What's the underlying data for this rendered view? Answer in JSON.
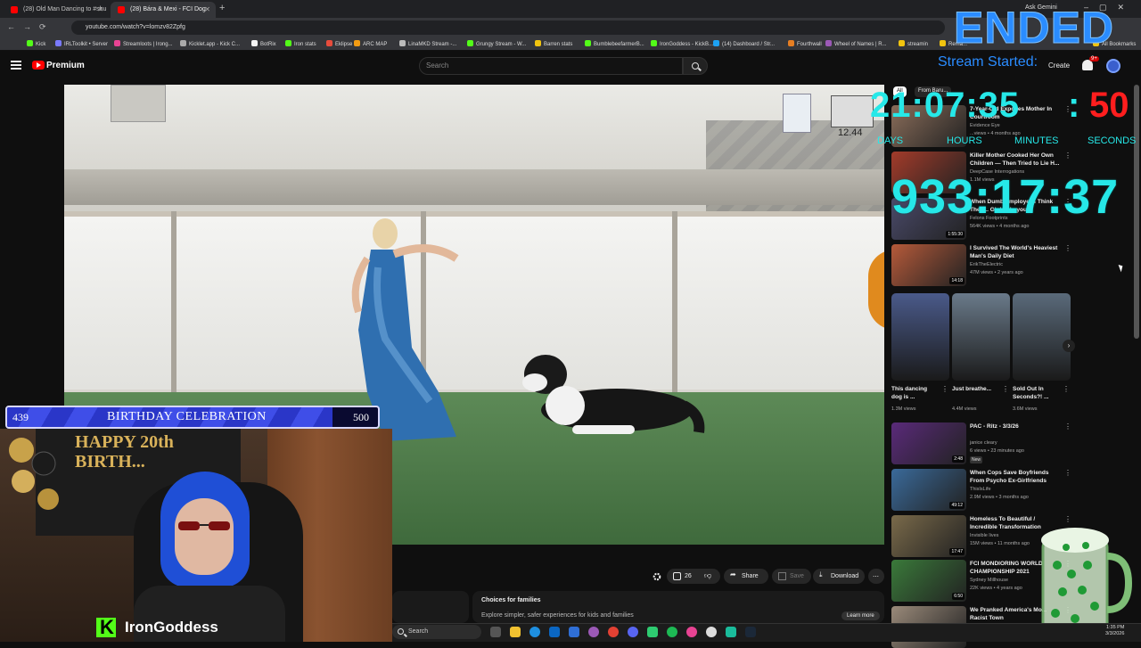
{
  "browser": {
    "tabs": [
      {
        "label": "(28) Old Man Dancing to #shu"
      },
      {
        "label": "(28) Bára & Mexi - FCI Dog"
      }
    ],
    "new_tab": "+",
    "ask_gemini": "Ask Gemini",
    "url": "youtube.com/watch?v=lomzv82Zpfg",
    "bookmarks": [
      "Kick",
      "IRLToolkit • Server",
      "Streamloots | Irong...",
      "Kicklet.app - Kick C...",
      "BotRix",
      "Iron stats",
      "Eklipse",
      "ARC MAP",
      "LinaMKD Stream -...",
      "Grungy Stream - W...",
      "Barren stats",
      "BumblebeefarmerB...",
      "IronGoddess - KickB...",
      "(14) Dashboard / Str...",
      "Fourthwall",
      "Wheel of Names | R...",
      "streamin",
      "Rema...",
      "All Bookmarks"
    ]
  },
  "youtube": {
    "logo_text": "Premium",
    "search_placeholder": "Search",
    "create_label": "Create",
    "notif_count": "9+",
    "video_overlay": {
      "score": "12.44"
    },
    "actions": {
      "like_count": "26",
      "share": "Share",
      "save": "Save",
      "download": "Download"
    },
    "family_card": {
      "title": "Choices for families",
      "subtitle": "Explore simpler, safer experiences for kids and families",
      "cta": "Learn more"
    },
    "chips": [
      "All",
      "From Baru..."
    ],
    "sidebar_videos": [
      {
        "title": "7-Year-Old Exposes Mother In Courtroom",
        "channel": "Evidence Eye",
        "meta": "...views • 4 months ago",
        "duration": ""
      },
      {
        "title": "Killer Mother Cooked Her Own Children — Then Tried to Lie H...",
        "channel": "DeepCase Interrogations",
        "meta": "1.1M views",
        "duration": ""
      },
      {
        "title": "When Dumb Employees Think Their... Global Layout",
        "channel": "Felons Footprints",
        "meta": "564K views • 4 months ago",
        "duration": "1:55:30"
      },
      {
        "title": "I Survived The World's Heaviest Man's Daily Diet",
        "channel": "ErikTheElectric",
        "meta": "47M views • 2 years ago",
        "duration": "14:18"
      }
    ],
    "shorts": [
      {
        "title": "This dancing dog is ...",
        "views": "1.3M views"
      },
      {
        "title": "Just breathe...",
        "views": "4.4M views"
      },
      {
        "title": "Sold Out In Seconds?! ...",
        "views": "3.6M views"
      }
    ],
    "sidebar_videos_2": [
      {
        "title": "PAC - Ritz - 3/3/26",
        "channel": "janice cleary",
        "meta": "6 views • 23 minutes ago",
        "duration": "2:48",
        "badge": "New"
      },
      {
        "title": "When Cops Save Boyfriends From Psycho Ex-Girlfriends",
        "channel": "ThisIsLife",
        "meta": "2.9M views • 3 months ago",
        "duration": "49:12"
      },
      {
        "title": "Homeless To Beautiful / Incredible Transformation",
        "channel": "Invisible lives",
        "meta": "15M views • 11 months ago",
        "duration": "17:47"
      },
      {
        "title": "FCI MONDIORING WORLD CHAMPIONSHIP 2021",
        "channel": "Sydney Millhouse",
        "meta": "22K views • 4 years ago",
        "duration": "6:50"
      },
      {
        "title": "We Pranked America's Mo... Racist Town",
        "channel": "",
        "meta": "",
        "duration": ""
      }
    ]
  },
  "overlay": {
    "ended": "ENDED",
    "stream_started": "Stream Started:",
    "countdown": {
      "days": "21",
      "hours": "07",
      "minutes": "35",
      "seconds": "50"
    },
    "countdown_labels": {
      "days": "DAYS",
      "hours": "HOURS",
      "minutes": "MINUTES",
      "seconds": "SECONDS"
    },
    "elapsed": "933:17:37",
    "goal": {
      "current": "439",
      "title": "BIRTHDAY CELEBRATION",
      "target": "500",
      "progress": 0.878
    },
    "banner_text": "HAPPY 20th BIRTH...",
    "streamer": "IronGoddess"
  },
  "taskbar": {
    "search": "Search",
    "time": "1:35 PM",
    "date": "3/3/2026"
  }
}
